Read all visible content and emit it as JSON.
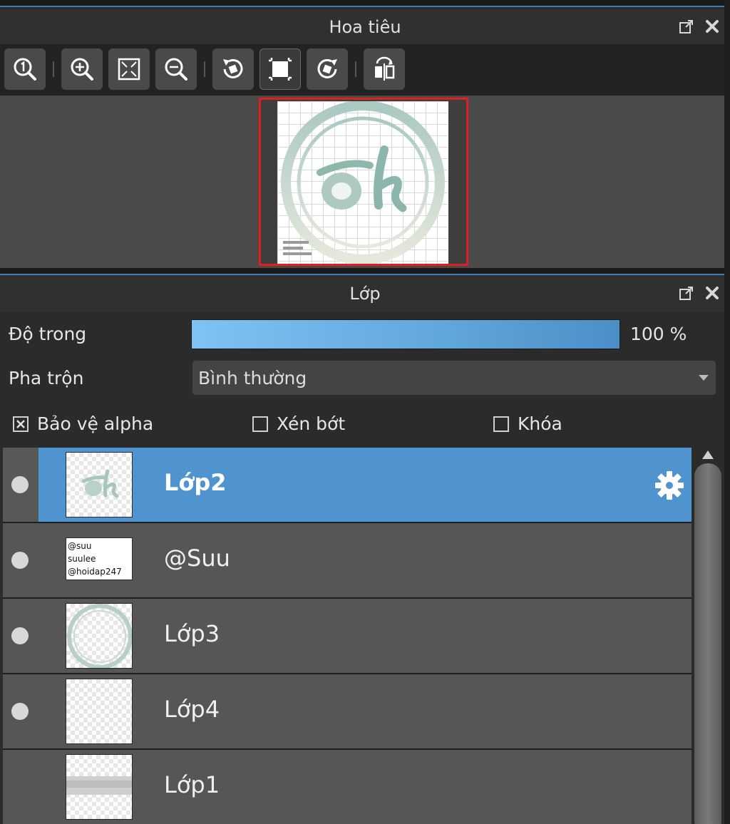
{
  "navigator": {
    "title": "Hoa tiêu",
    "toolbar": [
      {
        "name": "zoom-actual-button",
        "icon": "zoom-one-icon"
      },
      {
        "name": "zoom-in-button",
        "icon": "zoom-in-icon"
      },
      {
        "name": "fit-window-button",
        "icon": "fit-window-icon"
      },
      {
        "name": "zoom-out-button",
        "icon": "zoom-out-icon"
      },
      {
        "name": "rotate-left-button",
        "icon": "rotate-left-icon"
      },
      {
        "name": "reset-view-button",
        "icon": "reset-view-icon"
      },
      {
        "name": "rotate-right-button",
        "icon": "rotate-right-icon"
      },
      {
        "name": "flip-horizontal-button",
        "icon": "flip-icon"
      }
    ]
  },
  "layers_panel": {
    "title": "Lớp",
    "opacity_label": "Độ trong",
    "opacity_value": "100 %",
    "opacity_fraction": 1.0,
    "blend_label": "Pha trộn",
    "blend_value": "Bình thường",
    "options": {
      "protect_alpha": {
        "label": "Bảo vệ alpha",
        "checked": true
      },
      "clipping": {
        "label": "Xén bớt",
        "checked": false
      },
      "lock": {
        "label": "Khóa",
        "checked": false
      }
    },
    "layers": [
      {
        "name": "Lớp2",
        "visible": true,
        "selected": true
      },
      {
        "name": "@Suu",
        "visible": true,
        "selected": false,
        "thumb_text": "@suu\nsuulee\n@hoidap247"
      },
      {
        "name": "Lớp3",
        "visible": true,
        "selected": false
      },
      {
        "name": "Lớp4",
        "visible": true,
        "selected": false
      },
      {
        "name": "Lớp1",
        "visible": false,
        "selected": false
      }
    ]
  },
  "colors": {
    "accent_blue": "#4f94cf",
    "preview_border": "#e02020",
    "opacity_fill": "#6fb4eb"
  }
}
